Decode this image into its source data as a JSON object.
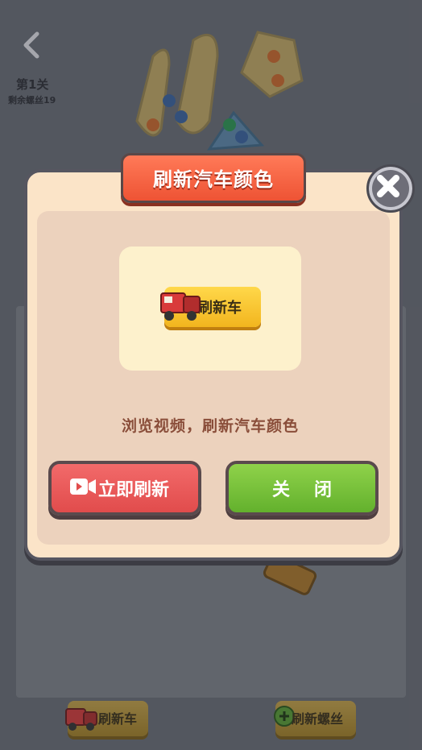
{
  "hud": {
    "level_label": "第1关",
    "screws_remaining": "剩余螺丝19"
  },
  "bottom_bar": {
    "refresh_car_label": "刷新车",
    "refresh_screw_label": "刷新螺丝"
  },
  "modal": {
    "title": "刷新汽车颜色",
    "preview_button_label": "刷新车",
    "description": "浏览视频，刷新汽车颜色",
    "refresh_now_label": "立即刷新",
    "close_label": "关闭"
  },
  "colors": {
    "title_banner": "#ee5334",
    "refresh_button": "#e14c4c",
    "close_button": "#63b12d",
    "modal_bg": "#fbe4c8"
  },
  "icons": [
    "back-arrow-icon",
    "video-icon",
    "truck-icon",
    "screw-icon",
    "close-icon"
  ]
}
